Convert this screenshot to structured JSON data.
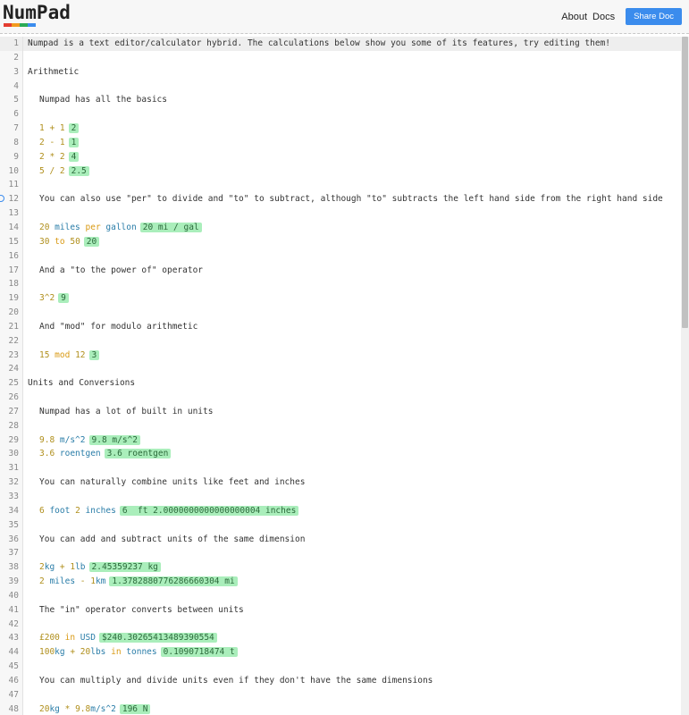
{
  "header": {
    "logo": "NumPad",
    "logo_colors": [
      "#e43d30",
      "#f29a1e",
      "#2bab55",
      "#3b8ced"
    ],
    "nav": [
      "About",
      "Docs"
    ],
    "share_label": "Share Doc"
  },
  "editor": {
    "active_line": 1,
    "lines": [
      {
        "n": "1",
        "t": [
          [
            "txt",
            "Numpad is a text editor/calculator hybrid. The calculations below show you some of its features, try editing them!"
          ]
        ]
      },
      {
        "n": "2",
        "t": []
      },
      {
        "n": "3",
        "t": [
          [
            "txt",
            "Arithmetic"
          ]
        ]
      },
      {
        "n": "4",
        "t": []
      },
      {
        "n": "5",
        "i": 1,
        "t": [
          [
            "txt",
            "Numpad has all the basics"
          ]
        ]
      },
      {
        "n": "6",
        "t": []
      },
      {
        "n": "7",
        "i": 1,
        "t": [
          [
            "num",
            "1 + 1"
          ],
          [
            "res",
            "2"
          ]
        ]
      },
      {
        "n": "8",
        "i": 1,
        "t": [
          [
            "num",
            "2 - 1"
          ],
          [
            "res",
            "1"
          ]
        ]
      },
      {
        "n": "9",
        "i": 1,
        "t": [
          [
            "num",
            "2 * 2"
          ],
          [
            "res",
            "4"
          ]
        ]
      },
      {
        "n": "10",
        "i": 1,
        "t": [
          [
            "num",
            "5 / 2"
          ],
          [
            "res",
            "2.5"
          ]
        ]
      },
      {
        "n": "11",
        "t": []
      },
      {
        "n": "12",
        "i": 1,
        "t": [
          [
            "txt",
            "You can also use \"per\" to divide and \"to\" to subtract, although \"to\" subtracts the left hand side from the right hand side"
          ]
        ]
      },
      {
        "n": "13",
        "t": []
      },
      {
        "n": "14",
        "i": 1,
        "t": [
          [
            "num",
            "20 "
          ],
          [
            "unit",
            "miles "
          ],
          [
            "kw",
            "per "
          ],
          [
            "unit",
            "gallon"
          ],
          [
            "res",
            "20 mi / gal"
          ]
        ]
      },
      {
        "n": "15",
        "i": 1,
        "t": [
          [
            "num",
            "30 "
          ],
          [
            "kw",
            "to "
          ],
          [
            "num",
            "50"
          ],
          [
            "res",
            "20"
          ]
        ]
      },
      {
        "n": "16",
        "t": []
      },
      {
        "n": "17",
        "i": 1,
        "t": [
          [
            "txt",
            "And a \"to the power of\" operator"
          ]
        ]
      },
      {
        "n": "18",
        "t": []
      },
      {
        "n": "19",
        "i": 1,
        "t": [
          [
            "num",
            "3^2"
          ],
          [
            "res",
            "9"
          ]
        ]
      },
      {
        "n": "20",
        "t": []
      },
      {
        "n": "21",
        "i": 1,
        "t": [
          [
            "txt",
            "And \"mod\" for modulo arithmetic"
          ]
        ]
      },
      {
        "n": "22",
        "t": []
      },
      {
        "n": "23",
        "i": 1,
        "t": [
          [
            "num",
            "15 "
          ],
          [
            "kw",
            "mod "
          ],
          [
            "num",
            "12"
          ],
          [
            "res",
            "3"
          ]
        ]
      },
      {
        "n": "24",
        "t": []
      },
      {
        "n": "25",
        "t": [
          [
            "txt",
            "Units and Conversions"
          ]
        ]
      },
      {
        "n": "26",
        "t": []
      },
      {
        "n": "27",
        "i": 1,
        "t": [
          [
            "txt",
            "Numpad has a lot of built in units"
          ]
        ]
      },
      {
        "n": "28",
        "t": []
      },
      {
        "n": "29",
        "i": 1,
        "t": [
          [
            "num",
            "9.8 "
          ],
          [
            "unit",
            "m/s^2"
          ],
          [
            "res",
            "9.8 m/s^2"
          ]
        ]
      },
      {
        "n": "30",
        "i": 1,
        "t": [
          [
            "num",
            "3.6 "
          ],
          [
            "unit",
            "roentgen"
          ],
          [
            "res",
            "3.6 roentgen"
          ]
        ]
      },
      {
        "n": "31",
        "t": []
      },
      {
        "n": "32",
        "i": 1,
        "t": [
          [
            "txt",
            "You can naturally combine units like feet and inches"
          ]
        ]
      },
      {
        "n": "33",
        "t": []
      },
      {
        "n": "34",
        "i": 1,
        "t": [
          [
            "num",
            "6 "
          ],
          [
            "unit",
            "foot "
          ],
          [
            "num",
            "2 "
          ],
          [
            "unit",
            "inches"
          ],
          [
            "res",
            "6  ft 2.0000000000000000004 inches"
          ]
        ]
      },
      {
        "n": "35",
        "t": []
      },
      {
        "n": "36",
        "i": 1,
        "t": [
          [
            "txt",
            "You can add and subtract units of the same dimension"
          ]
        ]
      },
      {
        "n": "37",
        "t": []
      },
      {
        "n": "38",
        "i": 1,
        "t": [
          [
            "num",
            "2"
          ],
          [
            "unit",
            "kg "
          ],
          [
            "num",
            "+ 1"
          ],
          [
            "unit",
            "lb"
          ],
          [
            "res",
            "2.45359237 kg"
          ]
        ]
      },
      {
        "n": "39",
        "i": 1,
        "t": [
          [
            "num",
            "2 "
          ],
          [
            "unit",
            "miles "
          ],
          [
            "num",
            "- 1"
          ],
          [
            "unit",
            "km"
          ],
          [
            "res",
            "1.3782880776286660304 mi"
          ]
        ]
      },
      {
        "n": "40",
        "t": []
      },
      {
        "n": "41",
        "i": 1,
        "t": [
          [
            "txt",
            "The \"in\" operator converts between units"
          ]
        ]
      },
      {
        "n": "42",
        "t": []
      },
      {
        "n": "43",
        "i": 1,
        "t": [
          [
            "num",
            "£200 "
          ],
          [
            "kw",
            "in "
          ],
          [
            "unit",
            "USD"
          ],
          [
            "res",
            "$240.30265413489390554"
          ]
        ]
      },
      {
        "n": "44",
        "i": 1,
        "t": [
          [
            "num",
            "100"
          ],
          [
            "unit",
            "kg "
          ],
          [
            "num",
            "+ 20"
          ],
          [
            "unit",
            "lbs "
          ],
          [
            "kw",
            "in "
          ],
          [
            "unit",
            "tonnes"
          ],
          [
            "res",
            "0.1090718474 t"
          ]
        ]
      },
      {
        "n": "45",
        "t": []
      },
      {
        "n": "46",
        "i": 1,
        "t": [
          [
            "txt",
            "You can multiply and divide units even if they don't have the same dimensions"
          ]
        ]
      },
      {
        "n": "47",
        "t": []
      },
      {
        "n": "48",
        "i": 1,
        "t": [
          [
            "num",
            "20"
          ],
          [
            "unit",
            "kg "
          ],
          [
            "num",
            "* 9.8"
          ],
          [
            "unit",
            "m/s^2"
          ],
          [
            "res",
            "196 N"
          ]
        ]
      }
    ]
  }
}
